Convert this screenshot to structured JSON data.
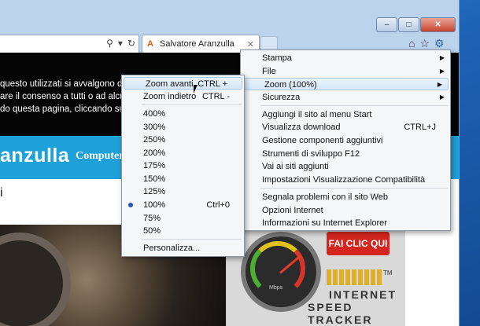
{
  "tab": {
    "title": "Salvatore Aranzulla",
    "favicon": "aranzulla-logo-icon"
  },
  "page": {
    "notice_lines": [
      "questo utilizzati si avvalgono di co",
      "are il consenso a tutti o ad alcuni",
      "do questa pagina, cliccando su un"
    ],
    "brand": "anzulla",
    "nav_link": "Computer",
    "heading_fragment": "i"
  },
  "ad": {
    "button": "FAI CLIC QUI",
    "gauge_label": "Mbps",
    "tm": "TM",
    "line1": "INTERNET",
    "line2": "SPEED TRACKER"
  },
  "tools_menu": [
    {
      "label": "Stampa",
      "submenu": true
    },
    {
      "label": "File",
      "submenu": true
    },
    {
      "label": "Zoom (100%)",
      "submenu": true,
      "highlighted": true
    },
    {
      "label": "Sicurezza",
      "submenu": true
    },
    {
      "label": "Aggiungi il sito al menu Start"
    },
    {
      "label": "Visualizza download",
      "shortcut": "CTRL+J"
    },
    {
      "label": "Gestione componenti aggiuntivi"
    },
    {
      "label": "Strumenti di sviluppo F12"
    },
    {
      "label": "Vai ai siti aggiunti"
    },
    {
      "label": "Impostazioni Visualizzazione Compatibilità"
    },
    {
      "label": "Segnala problemi con il sito Web"
    },
    {
      "label": "Opzioni Internet"
    },
    {
      "label": "Informazioni su Internet Explorer"
    }
  ],
  "zoom_menu": [
    {
      "label": "Zoom avanti",
      "shortcut": "CTRL +",
      "highlighted": true
    },
    {
      "label": "Zoom indietro",
      "shortcut": "CTRL -"
    },
    {
      "label": "400%"
    },
    {
      "label": "300%"
    },
    {
      "label": "250%"
    },
    {
      "label": "200%"
    },
    {
      "label": "175%"
    },
    {
      "label": "150%"
    },
    {
      "label": "125%"
    },
    {
      "label": "100%",
      "shortcut": "Ctrl+0",
      "selected": true
    },
    {
      "label": "75%"
    },
    {
      "label": "50%"
    },
    {
      "label": "Personalizza..."
    }
  ]
}
